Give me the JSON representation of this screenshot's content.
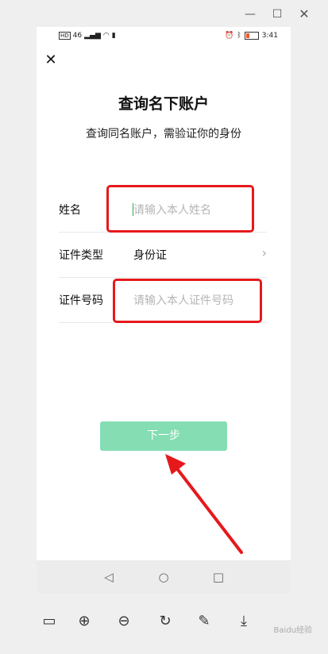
{
  "status_bar": {
    "left_text": "HD",
    "network": "46",
    "time": "3:41"
  },
  "page": {
    "title": "查询名下账户",
    "subtitle": "查询同名账户，需验证你的身份"
  },
  "form": {
    "name": {
      "label": "姓名",
      "placeholder": "请输入本人姓名"
    },
    "id_type": {
      "label": "证件类型",
      "value": "身份证"
    },
    "id_number": {
      "label": "证件号码",
      "placeholder": "请输入本人证件号码"
    }
  },
  "next_button": {
    "label": "下一步",
    "color": "#84ddb3"
  },
  "annotation": {
    "box_color": "#e5191c"
  },
  "watermark": "Baidu经验"
}
